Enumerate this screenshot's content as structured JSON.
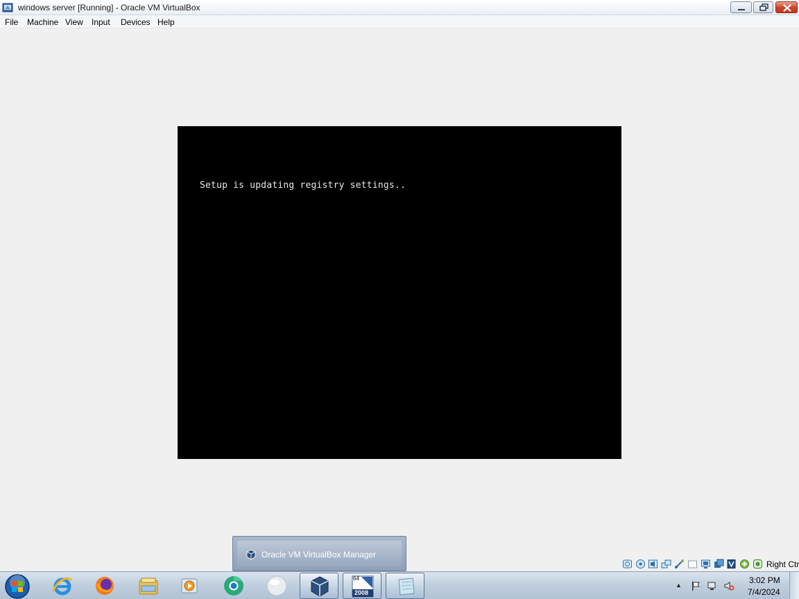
{
  "window": {
    "title": "windows server [Running] - Oracle VM VirtualBox"
  },
  "menu": {
    "items": [
      "File",
      "Machine",
      "View",
      "Input",
      "Devices",
      "Help"
    ]
  },
  "vm": {
    "console_text": "Setup is updating registry settings.."
  },
  "status_bar": {
    "icons": [
      "hard-disk-icon",
      "optical-drive-icon",
      "audio-icon",
      "network-icon",
      "usb-icon",
      "shared-folders-icon",
      "display-icon",
      "video-capture-icon",
      "cpu-icon",
      "mouse-integration-icon",
      "green-status-icon"
    ],
    "host_key": "Right Ctrl"
  },
  "taskbar": {
    "popup_label": "Oracle VM VirtualBox Manager",
    "buttons": [
      "internet-explorer-icon",
      "firefox-icon",
      "file-explorer-icon",
      "media-player-icon",
      "chrome-icon",
      "white-globe-icon",
      "virtualbox-icon",
      "windows-server-2008-icon",
      "notepad-icon"
    ],
    "server_badge_top": "64",
    "server_badge_bottom": "2008",
    "clock_time": "3:02 PM",
    "clock_date": "7/4/2024"
  },
  "colors": {
    "vm_background": "#000000",
    "console_text": "#e8e8e8",
    "window_background": "#f0f0f0",
    "close_button": "#c8432a"
  }
}
